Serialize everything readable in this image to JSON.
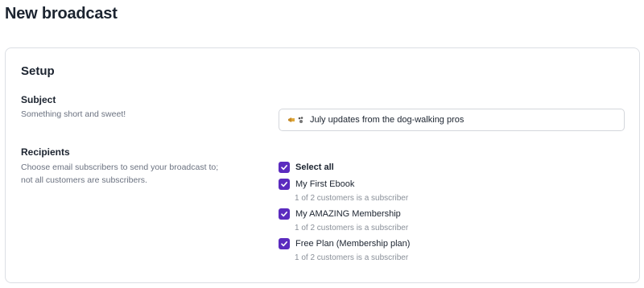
{
  "page": {
    "title": "New broadcast"
  },
  "setup": {
    "title": "Setup",
    "subject": {
      "label": "Subject",
      "description": "Something short and sweet!",
      "value": "July updates from the dog-walking pros",
      "prefix_icons": [
        "megaphone-icon",
        "paw-prints-icon"
      ]
    },
    "recipients": {
      "label": "Recipients",
      "description_line1": "Choose email subscribers to send your broadcast to;",
      "description_line2": "not all customers are subscribers.",
      "select_all": {
        "label": "Select all",
        "checked": true
      },
      "options": [
        {
          "label": "My First Ebook",
          "subtext": "1 of 2 customers is a subscriber",
          "checked": true
        },
        {
          "label": "My AMAZING Membership",
          "subtext": "1 of 2 customers is a subscriber",
          "checked": true
        },
        {
          "label": "Free Plan (Membership plan)",
          "subtext": "1 of 2 customers is a subscriber",
          "checked": true
        }
      ]
    }
  },
  "colors": {
    "accent": "#5b2bbf",
    "border": "#dcdfe4",
    "muted_text": "#6b7280"
  }
}
